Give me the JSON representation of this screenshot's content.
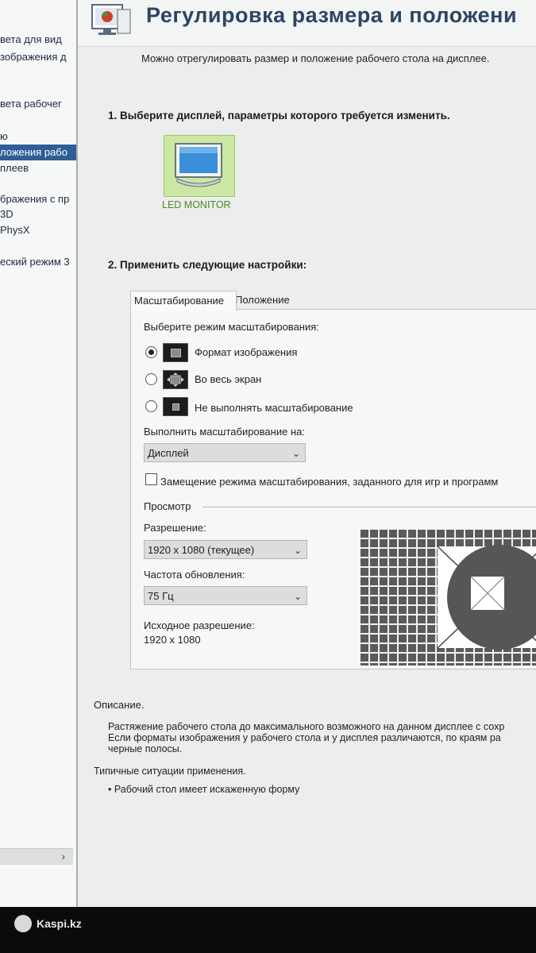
{
  "sidebar": {
    "items": [
      {
        "label": "вета для вид",
        "selected": false
      },
      {
        "label": "зображения д",
        "selected": false
      },
      {
        "label": "вета рабочег",
        "selected": false
      },
      {
        "label": "ю",
        "selected": false
      },
      {
        "label": "ложения рабо",
        "selected": true
      },
      {
        "label": "плеев",
        "selected": false
      },
      {
        "label": "бражения с пр",
        "selected": false
      },
      {
        "label": "3D",
        "selected": false
      },
      {
        "label": "PhysX",
        "selected": false
      },
      {
        "label": "еский режим 3",
        "selected": false
      }
    ],
    "scroll_arrow": "›"
  },
  "header": {
    "title": "Регулировка размера и положени",
    "subtitle": "Можно отрегулировать размер и положение рабочего стола на дисплее."
  },
  "step1": {
    "title": "1. Выберите дисплей, параметры которого требуется изменить.",
    "display_label": "LED MONITOR"
  },
  "step2": {
    "title": "2. Применить следующие настройки:"
  },
  "tabs": [
    {
      "label": "Масштабирование",
      "active": true
    },
    {
      "label": "Положение",
      "active": false
    }
  ],
  "scaling": {
    "mode_prompt": "Выберите режим масштабирования:",
    "modes": [
      {
        "label": "Формат изображения",
        "selected": true
      },
      {
        "label": "Во весь экран",
        "selected": false
      },
      {
        "label": "Не выполнять масштабирование",
        "selected": false
      }
    ],
    "perform_on_label": "Выполнить масштабирование на:",
    "perform_on_value": "Дисплей",
    "override_label": "Замещение режима масштабирования, заданного для игр и программ",
    "override_checked": false
  },
  "preview": {
    "group_label": "Просмотр",
    "resolution_label": "Разрешение:",
    "resolution_value": "1920 x 1080 (текущее)",
    "refresh_label": "Частота обновления:",
    "refresh_value": "75 Гц",
    "native_label": "Исходное разрешение:",
    "native_value": "1920 x 1080"
  },
  "description": {
    "title": "Описание.",
    "lines": [
      "Растяжение рабочего стола до максимального возможного на данном дисплее с сохр",
      "Если форматы изображения у рабочего стола и у дисплея различаются, по краям ра",
      "черные полосы."
    ],
    "usage_title": "Типичные ситуации применения.",
    "usage_item": "• Рабочий стол имеет искаженную форму"
  },
  "taskbar": {
    "brand": "Kaspi.kz"
  },
  "colors": {
    "title": "#2b4663",
    "selected_nav": "#2f5d96",
    "monitor_tile": "#cbe7a3",
    "monitor_label": "#4a8a1c"
  }
}
